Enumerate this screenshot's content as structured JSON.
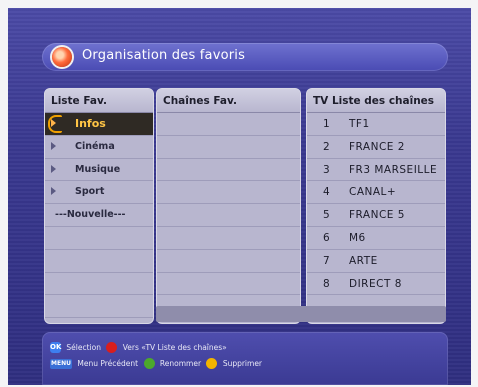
{
  "header": {
    "title": "Organisation des favoris"
  },
  "fav_list": {
    "title": "Liste Fav.",
    "items": [
      {
        "label": "Infos",
        "selected": true
      },
      {
        "label": "Cinéma"
      },
      {
        "label": "Musique"
      },
      {
        "label": "Sport"
      },
      {
        "label": "---Nouvelle---"
      }
    ]
  },
  "fav_channels": {
    "title": "Chaînes Fav."
  },
  "tv_list": {
    "title": "TV Liste des chaînes",
    "channels": [
      {
        "num": "1",
        "name": "TF1"
      },
      {
        "num": "2",
        "name": "FRANCE 2"
      },
      {
        "num": "3",
        "name": "FR3 MARSEILLE"
      },
      {
        "num": "4",
        "name": "CANAL+"
      },
      {
        "num": "5",
        "name": "FRANCE 5"
      },
      {
        "num": "6",
        "name": "M6"
      },
      {
        "num": "7",
        "name": "ARTE"
      },
      {
        "num": "8",
        "name": "DIRECT 8"
      }
    ]
  },
  "help": {
    "ok_key": "OK",
    "select_label": "Sélection",
    "red_label": "Vers «TV Liste des chaînes»",
    "menu_key": "MENU",
    "menu_label": "Menu Précédent",
    "green_label": "Renommer",
    "yellow_label": "Supprimer",
    "colors": {
      "red": "#d81e1e",
      "green": "#4ca82c",
      "yellow": "#f2b400"
    }
  }
}
